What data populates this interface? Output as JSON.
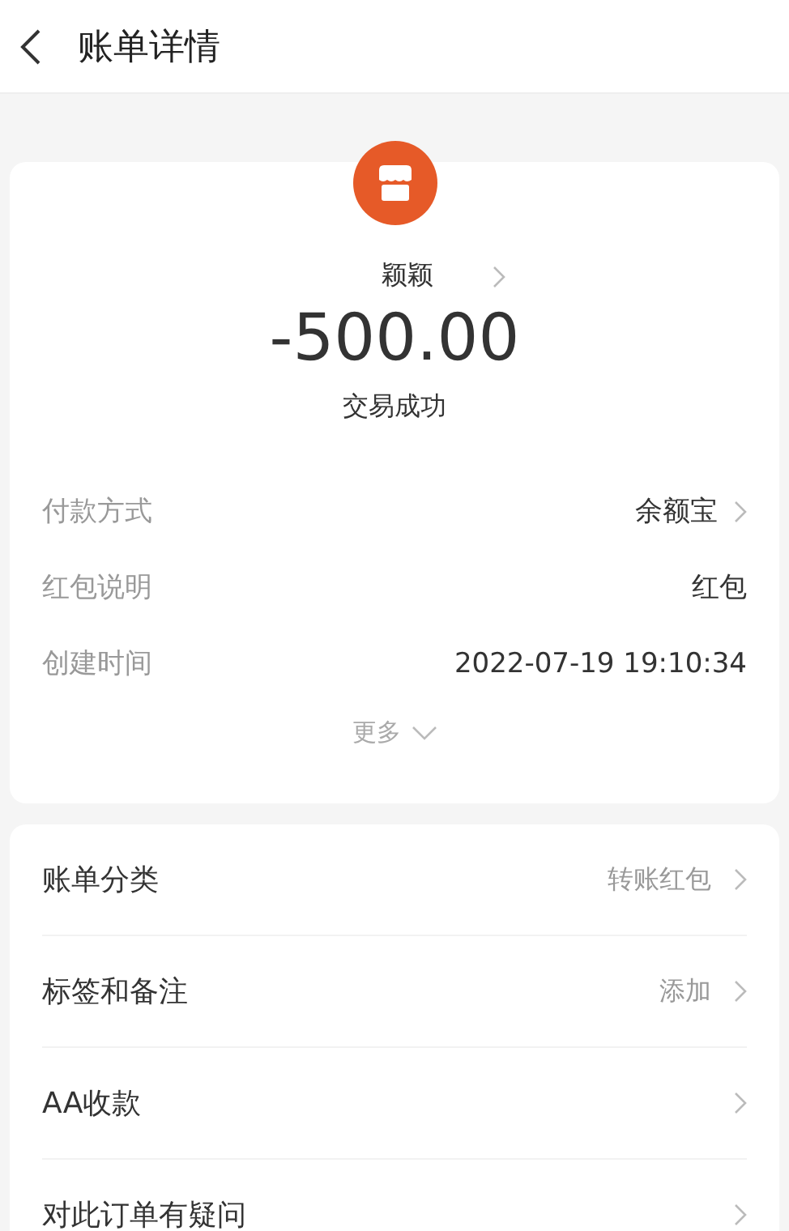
{
  "header": {
    "title": "账单详情"
  },
  "summary": {
    "name": "颖颖",
    "amount": "-500.00",
    "status": "交易成功"
  },
  "details": [
    {
      "label": "付款方式",
      "value": "余额宝",
      "link": true
    },
    {
      "label": "红包说明",
      "value": "红包",
      "link": false
    },
    {
      "label": "创建时间",
      "value": "2022-07-19 19:10:34",
      "link": false
    }
  ],
  "more": "更多",
  "actions": [
    {
      "label": "账单分类",
      "value": "转账红包"
    },
    {
      "label": "标签和备注",
      "value": "添加"
    },
    {
      "label": "AA收款"
    },
    {
      "label": "对此订单有疑问"
    }
  ]
}
